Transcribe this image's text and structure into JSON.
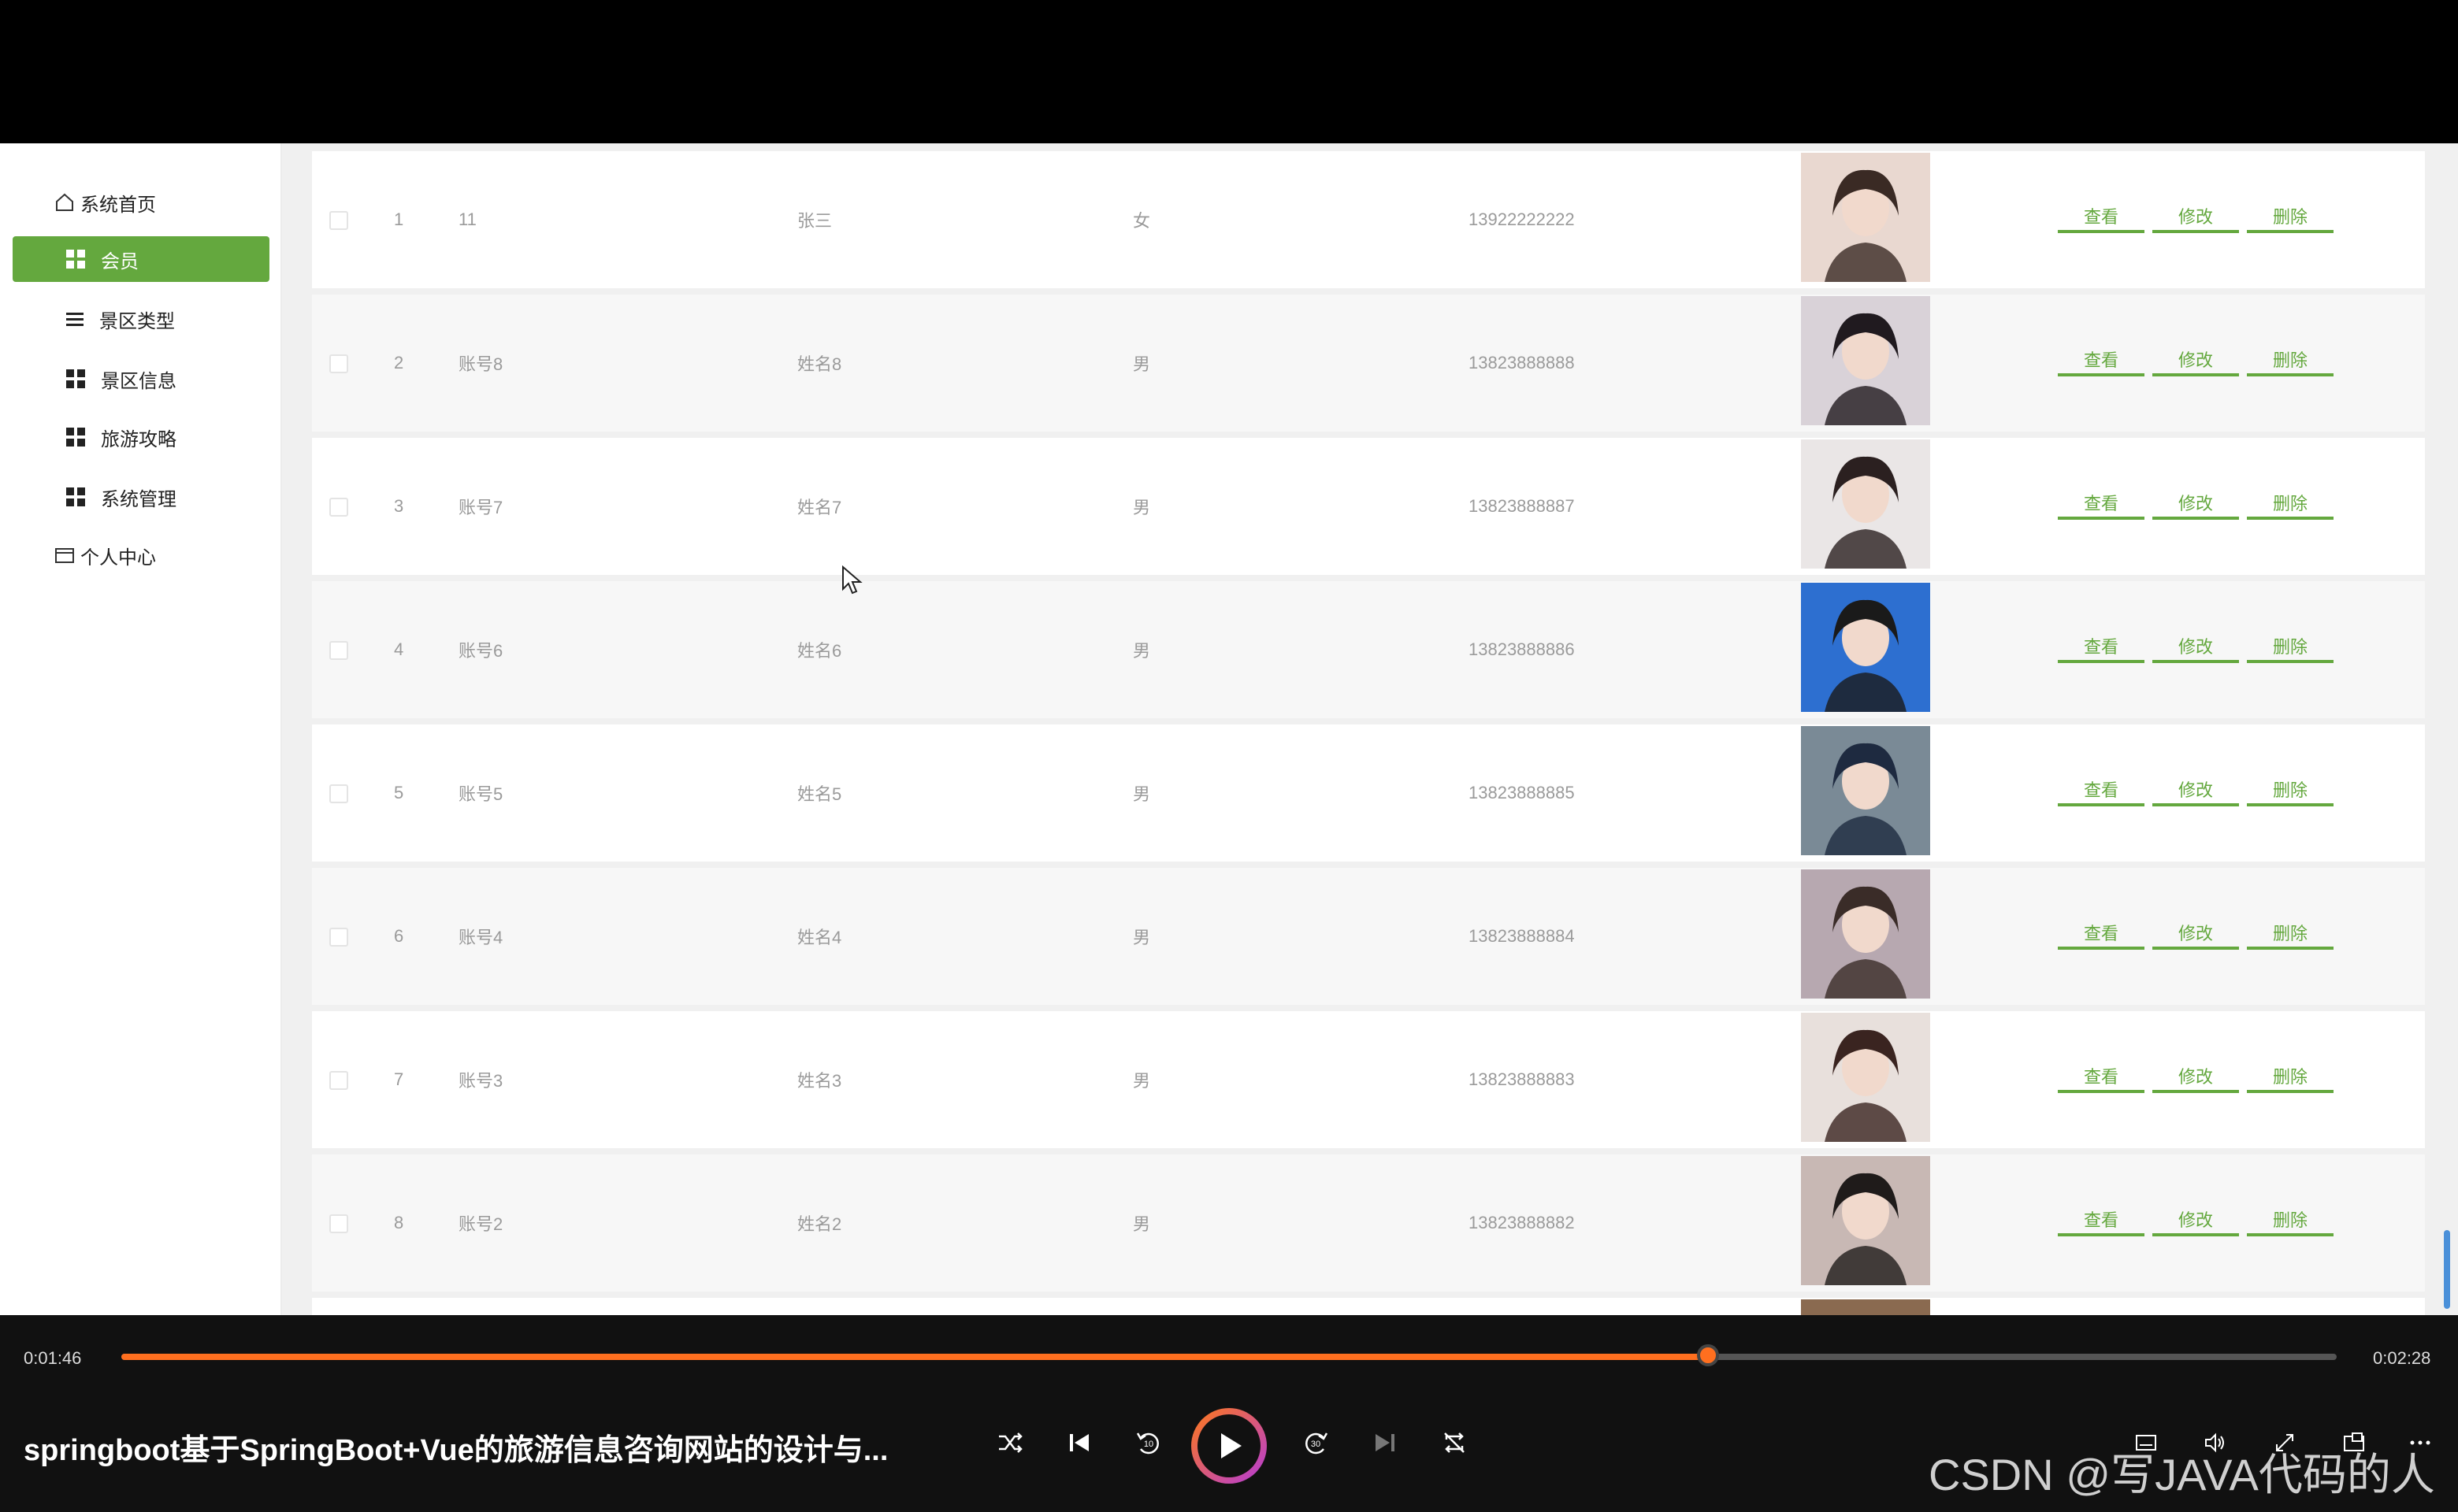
{
  "sidebar": {
    "home": "系统首页",
    "items": [
      {
        "label": "会员",
        "icon": "grid-icon"
      },
      {
        "label": "景区类型",
        "icon": "list-icon"
      },
      {
        "label": "景区信息",
        "icon": "grid-icon"
      },
      {
        "label": "旅游攻略",
        "icon": "grid-icon"
      },
      {
        "label": "系统管理",
        "icon": "grid-icon"
      }
    ],
    "profile": "个人中心"
  },
  "actions": {
    "view": "查看",
    "edit": "修改",
    "delete": "删除"
  },
  "rows": [
    {
      "index": "1",
      "account": "11",
      "name": "张三",
      "gender": "女",
      "phone": "13922222222"
    },
    {
      "index": "2",
      "account": "账号8",
      "name": "姓名8",
      "gender": "男",
      "phone": "13823888888"
    },
    {
      "index": "3",
      "account": "账号7",
      "name": "姓名7",
      "gender": "男",
      "phone": "13823888887"
    },
    {
      "index": "4",
      "account": "账号6",
      "name": "姓名6",
      "gender": "男",
      "phone": "13823888886"
    },
    {
      "index": "5",
      "account": "账号5",
      "name": "姓名5",
      "gender": "男",
      "phone": "13823888885"
    },
    {
      "index": "6",
      "account": "账号4",
      "name": "姓名4",
      "gender": "男",
      "phone": "13823888884"
    },
    {
      "index": "7",
      "account": "账号3",
      "name": "姓名3",
      "gender": "男",
      "phone": "13823888883"
    },
    {
      "index": "8",
      "account": "账号2",
      "name": "姓名2",
      "gender": "男",
      "phone": "13823888882"
    }
  ],
  "player": {
    "current_time": "0:01:46",
    "total_time": "0:02:28",
    "progress_fraction": 0.7162,
    "title": "springboot基于SpringBoot+Vue的旅游信息咨询网站的设计与...",
    "skip_back_label": "10",
    "skip_forward_label": "30",
    "watermark": "CSDN @写JAVA代码的人"
  },
  "colors": {
    "accent": "#64a83e",
    "progress": "#ff6f1f"
  }
}
